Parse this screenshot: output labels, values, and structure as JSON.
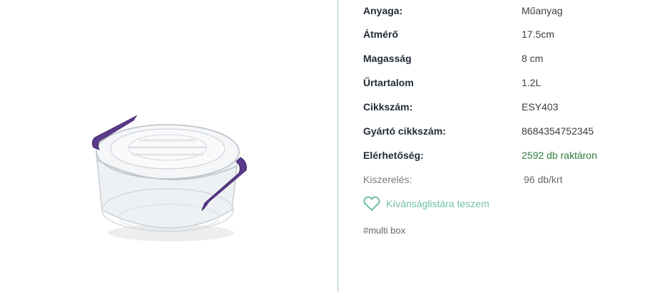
{
  "specs": [
    {
      "label": "Anyaga:",
      "value": "Műanyag"
    },
    {
      "label": "Átmérő",
      "value": "17.5cm"
    },
    {
      "label": "Magasság",
      "value": "8 cm"
    },
    {
      "label": "Űrtartalom",
      "value": "1.2L"
    },
    {
      "label": "Cikkszám:",
      "value": "ESY403"
    },
    {
      "label": "Gyártó cikkszám:",
      "value": "8684354752345"
    },
    {
      "label": "Elérhetőség:",
      "value": "2592 db raktáron"
    },
    {
      "label": "Kiszerelés:",
      "value": "96 db/krt"
    }
  ],
  "wishlist": {
    "label": "Kívánságlistára teszem",
    "icon": "heart-outline-icon"
  },
  "tag": "#multi box",
  "colors": {
    "accent": "#6fbfa5",
    "stock": "#2f7a3d",
    "handle": "#5b3a8c",
    "divider": "#9fcfbf"
  }
}
